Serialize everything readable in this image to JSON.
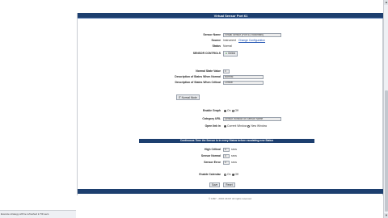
{
  "status_bar": {
    "text": "Execute strategy will be refreshed in 59 secs"
  },
  "panel": {
    "title": "Virtual Sensor Port 61"
  },
  "fields": {
    "sensor_name_label": "Sensor Name",
    "sensor_name_value": "Virtual Sensor (Port 61 bookmark)",
    "source_label": "Source",
    "source_value": "Instrument",
    "source_link": "Change Configuration",
    "status_label": "Status",
    "status_value": "Normal",
    "sensor_controls_label": "SENSOR CONTROLS",
    "sensor_controls_button": "Online",
    "normal_state_label": "Normal State Value",
    "normal_state_value": "0",
    "desc_normal_label": "Description of States When Normal",
    "desc_normal_value": "Normal",
    "desc_critical_label": "Description of States When Critical",
    "desc_critical_value": "Critical",
    "normal_mode_button": "IT Normal Mode",
    "enable_graph_label": "Enable Graph",
    "enable_graph_on": "On",
    "enable_graph_off": "Off",
    "category_label": "Category URL",
    "category_value": "Sensor Window on Sensor Name",
    "open_link_label": "Open link in",
    "open_link_opt1": "Current Window",
    "open_link_opt2": "New Window"
  },
  "continuous": {
    "header": "Continuous Time the Sensor is in every Status before escalating new Status",
    "high_critical_label": "High Critical",
    "high_critical_value": "0",
    "high_critical_unit": "secs",
    "sensor_normal_label": "Sensor Normal",
    "sensor_normal_value": "0",
    "sensor_normal_unit": "secs",
    "sensor_error_label": "Sensor Error",
    "sensor_error_value": "0",
    "sensor_error_unit": "secs",
    "enable_calendar_label": "Enable Calendar",
    "enable_calendar_on": "On",
    "enable_calendar_off": "Off"
  },
  "actions": {
    "save": "Save",
    "reset": "Reset"
  },
  "footer": {
    "copyright": "© 1997 - 2016 AKCP. All rights reserved"
  }
}
